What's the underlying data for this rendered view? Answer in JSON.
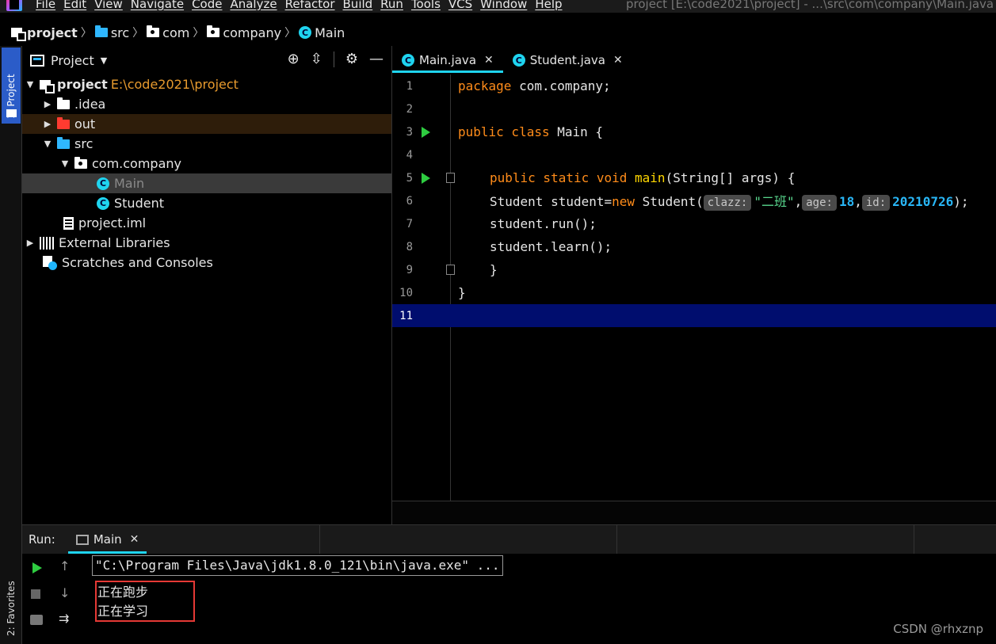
{
  "menu": {
    "items": [
      "File",
      "Edit",
      "View",
      "Navigate",
      "Code",
      "Analyze",
      "Refactor",
      "Build",
      "Run",
      "Tools",
      "VCS",
      "Window",
      "Help"
    ],
    "window_title": "project [E:\\code2021\\project] - ...\\src\\com\\company\\Main.java -"
  },
  "breadcrumb": [
    "project",
    "src",
    "com",
    "company",
    "Main"
  ],
  "project_panel": {
    "title": "Project",
    "tree": [
      {
        "label": "project",
        "path": "E:\\code2021\\project",
        "icon": "project-icon"
      },
      {
        "label": ".idea",
        "icon": "folder-icon"
      },
      {
        "label": "out",
        "icon": "excluded-folder-icon"
      },
      {
        "label": "src",
        "icon": "source-folder-icon"
      },
      {
        "label": "com.company",
        "icon": "package-icon"
      },
      {
        "label": "Main",
        "icon": "class-icon"
      },
      {
        "label": "Student",
        "icon": "class-icon"
      },
      {
        "label": "project.iml",
        "icon": "file-icon"
      },
      {
        "label": "External Libraries",
        "icon": "library-icon"
      },
      {
        "label": "Scratches and Consoles",
        "icon": "scratch-icon"
      }
    ]
  },
  "left_strip": {
    "project_label": "1: Project",
    "favorites_label": "2: Favorites"
  },
  "editor": {
    "tabs": [
      {
        "label": "Main.java",
        "active": true
      },
      {
        "label": "Student.java",
        "active": false
      }
    ],
    "line_numbers": [
      "1",
      "2",
      "3",
      "4",
      "5",
      "6",
      "7",
      "8",
      "9",
      "10",
      "11"
    ],
    "code": {
      "l1_kw": "package",
      "l1_rest": " com.company;",
      "l3_kw": "public class",
      "l3_rest": " Main {",
      "l5_kw": "public static void",
      "l5_fn": "main",
      "l5_rest": "(String[] args) {",
      "l6_a": "Student student=",
      "l6_new": "new",
      "l6_b": " Student(",
      "hint1": "clazz:",
      "arg1": "\"二班\"",
      "hint2": "age:",
      "arg2": "18",
      "hint3": "id:",
      "arg3": "20210726",
      "l6_end": ");",
      "l7": "student.run();",
      "l8": "student.learn();",
      "l9": "}",
      "l10": "}"
    }
  },
  "run_panel": {
    "label": "Run:",
    "tab": "Main",
    "command": "\"C:\\Program Files\\Java\\jdk1.8.0_121\\bin\\java.exe\" ...",
    "output": [
      "正在跑步",
      "正在学习"
    ]
  },
  "watermark": "CSDN @rhxznp",
  "colors": {
    "accent": "#1fd4ef",
    "keyword": "#ff8c1a",
    "current_line": "#000d6e",
    "highlight_box": "#e53935"
  }
}
